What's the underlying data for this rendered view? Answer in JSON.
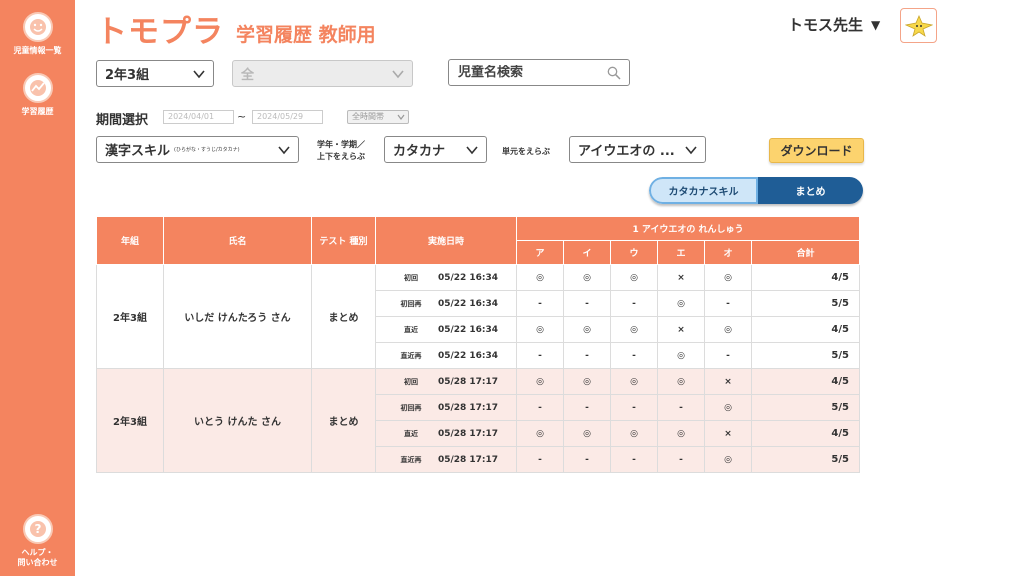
{
  "sidebar": {
    "items": [
      {
        "label": "児童情報一覧",
        "icon": "smiley-icon"
      },
      {
        "label": "学習履歴",
        "icon": "learning-chart-icon"
      },
      {
        "label": "ヘルプ・\n問い合わせ",
        "icon": "help-icon"
      }
    ]
  },
  "header": {
    "logo": "トモプラ",
    "subtitle": "学習履歴 教師用",
    "user_name": "トモス先生",
    "user_caret": "▼"
  },
  "filters": {
    "class_select": "2年3組",
    "student_select": "全",
    "search_placeholder": "児童名検索",
    "period_label": "期間選択",
    "date_from": "2024/04/01",
    "tilde": "~",
    "date_to": "2024/05/29",
    "time_select": "全時間帯",
    "skill_select": "漢字スキル",
    "skill_sub": "(ひらがな・すうじ/カタカナ)",
    "term_label": "学年・学期／\n上下をえらぶ",
    "term_select": "カタカナ",
    "unit_label": "単元をえらぶ",
    "unit_select": "アイウエオの ...",
    "download_label": "ダウンロード"
  },
  "view_toggle": {
    "options": [
      "カタカナスキル",
      "まとめ"
    ],
    "selected": "まとめ"
  },
  "table": {
    "headers": {
      "class": "年組",
      "name": "氏名",
      "test_type": "テスト 種別",
      "date": "実施日時",
      "unit_title": "1 アイウエオの れんしゅう",
      "cols": [
        "ア",
        "イ",
        "ウ",
        "エ",
        "オ",
        "合計"
      ]
    },
    "groups": [
      {
        "class": "2年3組",
        "name": "いしだ けんたろう さん",
        "test_type": "まとめ",
        "rows": [
          {
            "attempt": "初回",
            "datetime": "05/22 16:34",
            "marks": [
              "◎",
              "◎",
              "◎",
              "×",
              "◎"
            ],
            "total": "4/5"
          },
          {
            "attempt": "初回再",
            "datetime": "05/22 16:34",
            "marks": [
              "-",
              "-",
              "-",
              "◎",
              "-"
            ],
            "total": "5/5"
          },
          {
            "attempt": "直近",
            "datetime": "05/22 16:34",
            "marks": [
              "◎",
              "◎",
              "◎",
              "×",
              "◎"
            ],
            "total": "4/5"
          },
          {
            "attempt": "直近再",
            "datetime": "05/22 16:34",
            "marks": [
              "-",
              "-",
              "-",
              "◎",
              "-"
            ],
            "total": "5/5"
          }
        ]
      },
      {
        "class": "2年3組",
        "name": "いとう けんた さん",
        "test_type": "まとめ",
        "rows": [
          {
            "attempt": "初回",
            "datetime": "05/28 17:17",
            "marks": [
              "◎",
              "◎",
              "◎",
              "◎",
              "×"
            ],
            "total": "4/5"
          },
          {
            "attempt": "初回再",
            "datetime": "05/28 17:17",
            "marks": [
              "-",
              "-",
              "-",
              "-",
              "◎"
            ],
            "total": "5/5"
          },
          {
            "attempt": "直近",
            "datetime": "05/28 17:17",
            "marks": [
              "◎",
              "◎",
              "◎",
              "◎",
              "×"
            ],
            "total": "4/5"
          },
          {
            "attempt": "直近再",
            "datetime": "05/28 17:17",
            "marks": [
              "-",
              "-",
              "-",
              "-",
              "◎"
            ],
            "total": "5/5"
          }
        ]
      }
    ]
  },
  "colors": {
    "brand": "#f4845f",
    "row_alt": "#fbeae6",
    "download": "#fcd36e",
    "toggle_active": "#1f5d96",
    "toggle_inactive": "#cfe6f8"
  }
}
